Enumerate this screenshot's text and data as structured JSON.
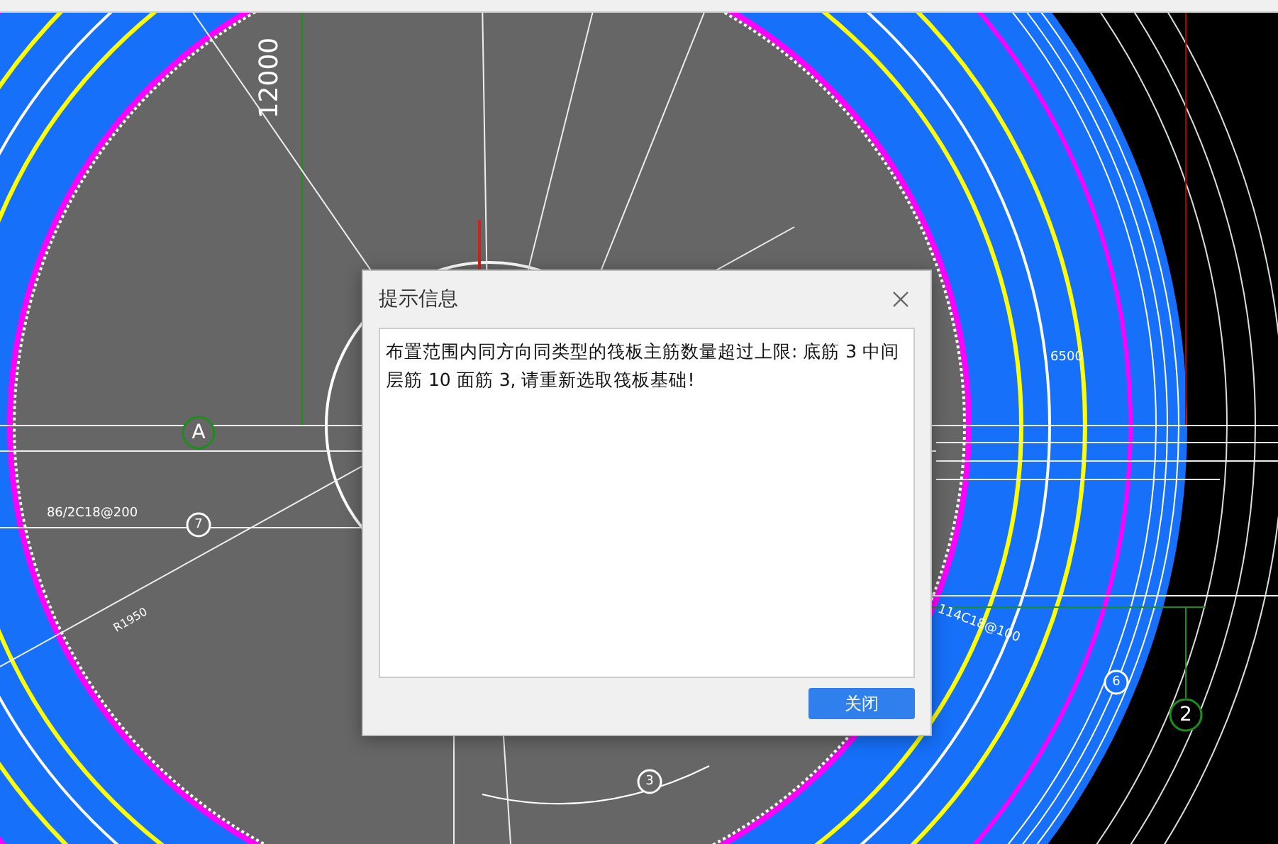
{
  "drawing": {
    "labels": [
      {
        "kind": "dimension",
        "text": "12000"
      },
      {
        "kind": "axis",
        "text": "A"
      },
      {
        "kind": "rebar",
        "text": "86/2C18@200"
      },
      {
        "kind": "marker",
        "text": "7"
      },
      {
        "kind": "dimension",
        "text": "6500"
      },
      {
        "kind": "axis",
        "text": "2"
      },
      {
        "kind": "marker",
        "text": "3"
      },
      {
        "kind": "marker",
        "text": "6"
      },
      {
        "kind": "rebar",
        "text": "114C18@100"
      },
      {
        "kind": "rebar",
        "text": "R1950"
      }
    ]
  },
  "dialog": {
    "title": "提示信息",
    "message": "布置范围内同方向同类型的筏板主筋数量超过上限: 底筋 3 中间层筋 10 面筋 3, 请重新选取筏板基础!",
    "buttons": [
      "关闭"
    ]
  }
}
